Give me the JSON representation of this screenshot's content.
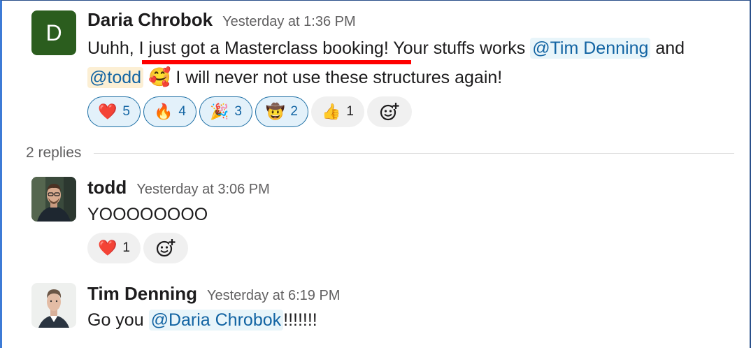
{
  "messages": [
    {
      "author": "Daria Chrobok",
      "avatar_letter": "D",
      "timestamp": "Yesterday at 1:36 PM",
      "line1_part1": "Uuhh, I just got a Masterclass booking! Your stuffs works ",
      "mention1": "@Tim Denning",
      "line1_part2": " and",
      "mention2": "@todd",
      "emoji": "🥰",
      "line2_part": " I will never not use these structures again!",
      "reactions": [
        {
          "emoji": "❤️",
          "count": "5"
        },
        {
          "emoji": "🔥",
          "count": "4"
        },
        {
          "emoji": "🎉",
          "count": "3"
        },
        {
          "emoji": "🤠",
          "count": "2"
        },
        {
          "emoji": "👍",
          "count": "1"
        }
      ]
    },
    {
      "author": "todd",
      "timestamp": "Yesterday at 3:06 PM",
      "text": "YOOOOOOOO",
      "reactions": [
        {
          "emoji": "❤️",
          "count": "1"
        }
      ]
    },
    {
      "author": "Tim Denning",
      "timestamp": "Yesterday at 6:19 PM",
      "text_prefix": "Go you ",
      "mention": "@Daria Chrobok",
      "text_suffix": "!!!!!!!"
    }
  ],
  "thread": {
    "replies_label": "2 replies"
  },
  "colors": {
    "mention_text": "#1264a3",
    "mention_bg": "#e8f5fa",
    "active_reaction_border": "#1d6fa5",
    "annotation_underline": "#ff0000",
    "avatar_bg": "#2b5d1e"
  }
}
